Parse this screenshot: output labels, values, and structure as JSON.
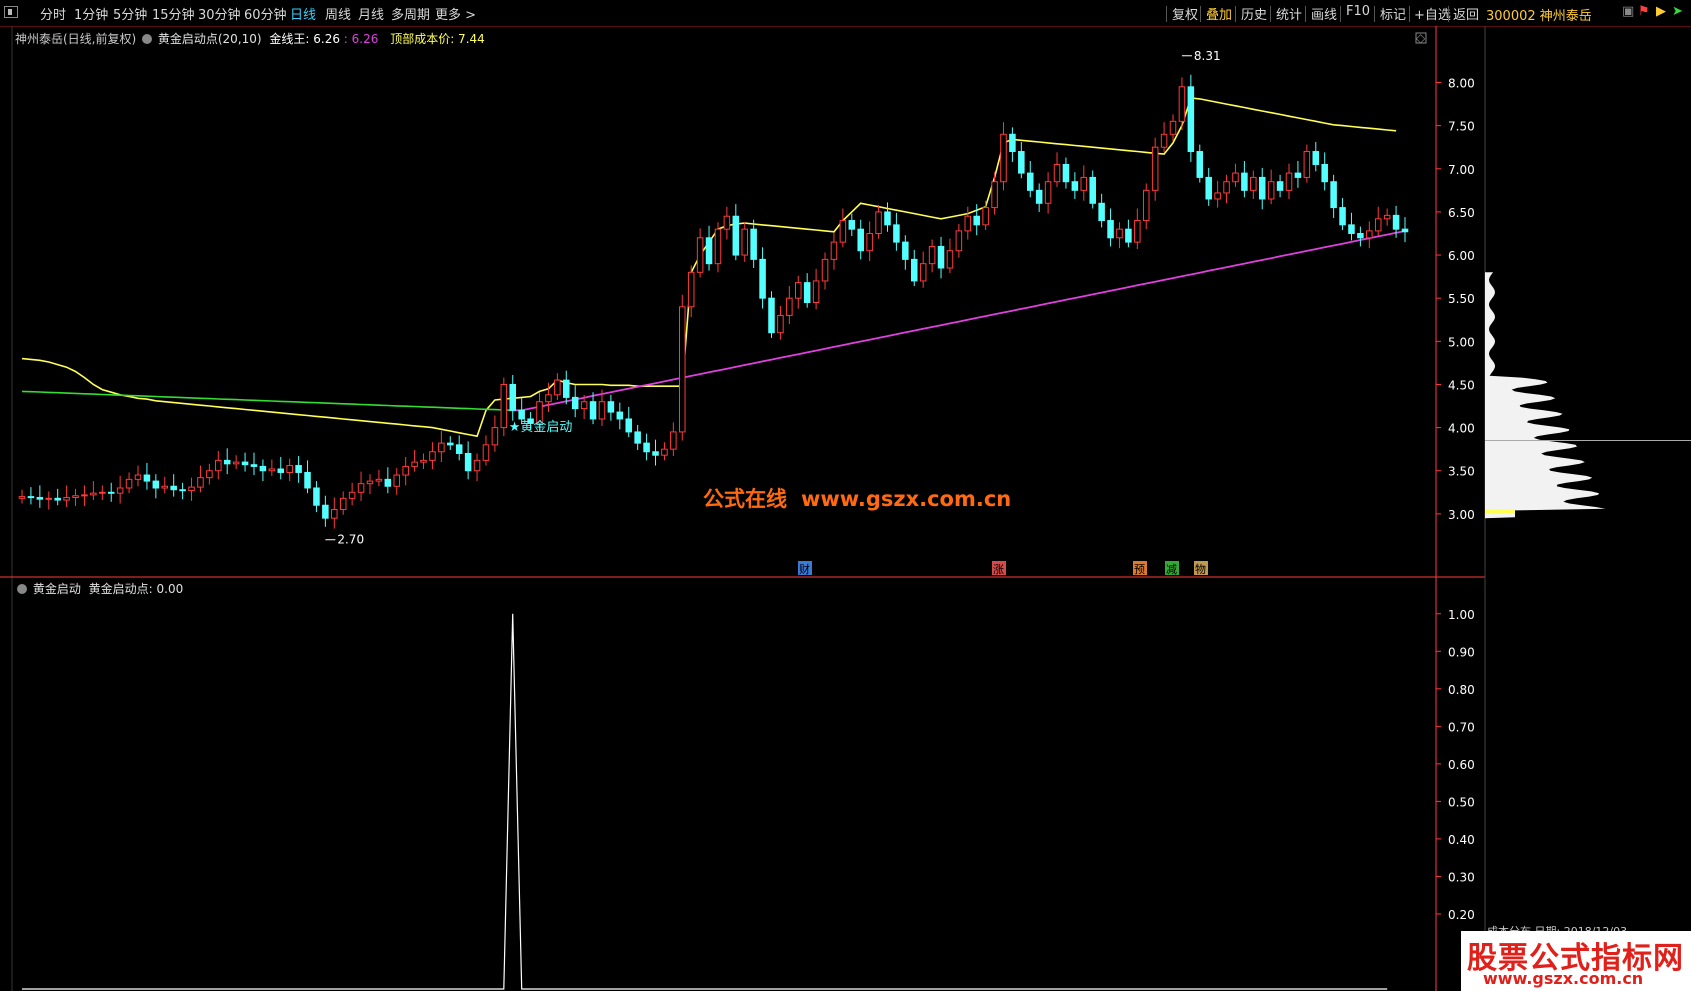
{
  "toolbar": {
    "periods": [
      "分时",
      "1分钟",
      "5分钟",
      "15分钟",
      "30分钟",
      "60分钟",
      "日线",
      "周线",
      "月线",
      "多周期",
      "更多 >"
    ],
    "active_period": "日线",
    "right": [
      "复权",
      "叠加",
      "历史",
      "统计",
      "画线",
      "F10",
      "标记",
      "+自选",
      "返回"
    ],
    "active_right": "叠加",
    "stock": "300002 神州泰岳"
  },
  "main_info": {
    "stock_label": "神州泰岳(日线,前复权)",
    "indicator": "黄金启动点(20,10)",
    "gold_label": "金线王: 6.26",
    "magenta_value": ": 6.26",
    "top_cost": "顶部成本价: 7.44"
  },
  "sub_info": {
    "name": "黄金启动",
    "value_label": "黄金启动点: 0.00"
  },
  "watermark": {
    "line1": "公式在线",
    "line2": "www.gszx.com.cn"
  },
  "corner_watermark": {
    "line1": "股票公式指标网",
    "line2": "www.gszx.com.cn"
  },
  "chip_text": "成本分布,日期: 2018/12/03",
  "colors": {
    "up": "#ff3a3a",
    "down": "#54ffff",
    "gold": "#ffff55",
    "magenta": "#e040e0",
    "green": "#33dd33",
    "axis": "#ff3a3a",
    "white": "#ffffff"
  },
  "chart_data": [
    {
      "type": "candlestick",
      "title": "神州泰岳(日线,前复权)",
      "ylim": [
        2.5,
        8.4
      ],
      "yticks": [
        3.0,
        3.5,
        4.0,
        4.5,
        5.0,
        5.5,
        6.0,
        6.5,
        7.0,
        7.5,
        8.0
      ],
      "annotations": [
        {
          "text": "8.31",
          "kind": "high"
        },
        {
          "text": "2.70",
          "kind": "low"
        },
        {
          "text": "黄金启动",
          "kind": "signal"
        }
      ],
      "event_markers": [
        "财",
        "涨",
        "预",
        "减",
        "物"
      ],
      "closes": [
        3.2,
        3.19,
        3.17,
        3.18,
        3.16,
        3.19,
        3.21,
        3.22,
        3.24,
        3.25,
        3.24,
        3.3,
        3.4,
        3.45,
        3.38,
        3.3,
        3.32,
        3.28,
        3.27,
        3.31,
        3.42,
        3.5,
        3.62,
        3.58,
        3.6,
        3.57,
        3.55,
        3.5,
        3.52,
        3.48,
        3.56,
        3.48,
        3.3,
        3.1,
        2.95,
        3.05,
        3.18,
        3.25,
        3.35,
        3.38,
        3.4,
        3.32,
        3.45,
        3.55,
        3.6,
        3.62,
        3.72,
        3.82,
        3.8,
        3.7,
        3.5,
        3.62,
        3.8,
        4.0,
        4.5,
        4.2,
        4.1,
        4.05,
        4.3,
        4.38,
        4.55,
        4.35,
        4.22,
        4.3,
        4.1,
        4.3,
        4.18,
        4.1,
        3.95,
        3.82,
        3.72,
        3.68,
        3.75,
        3.95,
        5.4,
        5.8,
        6.2,
        5.9,
        6.3,
        6.45,
        6.0,
        6.3,
        5.95,
        5.5,
        5.1,
        5.3,
        5.5,
        5.68,
        5.45,
        5.7,
        5.95,
        6.15,
        6.4,
        6.3,
        6.05,
        6.25,
        6.5,
        6.35,
        6.15,
        5.95,
        5.7,
        5.9,
        6.1,
        5.85,
        6.05,
        6.28,
        6.45,
        6.35,
        6.55,
        6.85,
        7.4,
        7.2,
        6.95,
        6.75,
        6.6,
        6.85,
        7.05,
        6.85,
        6.75,
        6.9,
        6.6,
        6.4,
        6.2,
        6.3,
        6.15,
        6.4,
        6.75,
        7.25,
        7.4,
        7.55,
        7.95,
        7.2,
        6.9,
        6.65,
        6.72,
        6.85,
        6.95,
        6.75,
        6.9,
        6.65,
        6.85,
        6.75,
        6.95,
        6.9,
        7.2,
        7.05,
        6.85,
        6.55,
        6.35,
        6.25,
        6.2,
        6.28,
        6.42,
        6.46,
        6.3,
        6.27
      ],
      "gold_line": [
        4.8,
        4.79,
        4.78,
        4.76,
        4.73,
        4.7,
        4.65,
        4.58,
        4.5,
        4.44,
        4.41,
        4.38,
        4.36,
        4.34,
        4.33,
        4.31,
        4.3,
        4.29,
        4.28,
        4.27,
        4.26,
        4.25,
        4.24,
        4.23,
        4.22,
        4.21,
        4.2,
        4.19,
        4.18,
        4.17,
        4.16,
        4.15,
        4.14,
        4.13,
        4.12,
        4.11,
        4.1,
        4.09,
        4.08,
        4.07,
        4.06,
        4.05,
        4.04,
        4.03,
        4.02,
        4.01,
        4.0,
        3.98,
        3.96,
        3.94,
        3.92,
        3.9,
        4.2,
        4.32,
        4.33,
        4.34,
        4.35,
        4.36,
        4.42,
        4.45,
        4.55,
        4.52,
        4.5,
        4.5,
        4.5,
        4.5,
        4.49,
        4.49,
        4.49,
        4.48,
        4.48,
        4.48,
        4.48,
        4.48,
        4.48,
        5.8,
        6.0,
        6.15,
        6.3,
        6.34,
        6.36,
        6.37,
        6.36,
        6.35,
        6.34,
        6.33,
        6.32,
        6.31,
        6.3,
        6.29,
        6.28,
        6.27,
        6.4,
        6.5,
        6.6,
        6.58,
        6.56,
        6.54,
        6.52,
        6.5,
        6.48,
        6.46,
        6.44,
        6.42,
        6.44,
        6.46,
        6.48,
        6.52,
        6.56,
        6.9,
        7.3,
        7.34,
        7.33,
        7.32,
        7.31,
        7.3,
        7.29,
        7.28,
        7.27,
        7.26,
        7.25,
        7.24,
        7.23,
        7.22,
        7.21,
        7.2,
        7.19,
        7.18,
        7.17,
        7.3,
        7.5,
        7.82,
        7.81,
        7.79,
        7.77,
        7.75,
        7.73,
        7.71,
        7.69,
        7.67,
        7.65,
        7.63,
        7.61,
        7.59,
        7.57,
        7.55,
        7.53,
        7.51,
        7.5,
        7.49,
        7.48,
        7.47,
        7.46,
        7.45,
        7.44
      ],
      "series_names": {
        "gold": "金线王",
        "magenta": "顶部成本价"
      }
    },
    {
      "type": "line",
      "title": "黄金启动点",
      "ylim": [
        0,
        1.05
      ],
      "yticks": [
        0.2,
        0.3,
        0.4,
        0.5,
        0.6,
        0.7,
        0.8,
        0.9,
        1.0
      ],
      "signal_index": 55,
      "values": [
        0,
        0,
        0,
        0,
        0,
        0,
        0,
        0,
        0,
        0,
        0,
        0,
        0,
        0,
        0,
        0,
        0,
        0,
        0,
        0,
        0,
        0,
        0,
        0,
        0,
        0,
        0,
        0,
        0,
        0,
        0,
        0,
        0,
        0,
        0,
        0,
        0,
        0,
        0,
        0,
        0,
        0,
        0,
        0,
        0,
        0,
        0,
        0,
        0,
        0,
        0,
        0,
        0,
        0,
        0,
        1,
        0,
        0,
        0,
        0,
        0,
        0,
        0,
        0,
        0,
        0,
        0,
        0,
        0,
        0,
        0,
        0,
        0,
        0,
        0,
        0,
        0,
        0,
        0,
        0,
        0,
        0,
        0,
        0,
        0,
        0,
        0,
        0,
        0,
        0,
        0,
        0,
        0,
        0,
        0,
        0,
        0,
        0,
        0,
        0,
        0,
        0,
        0,
        0,
        0,
        0,
        0,
        0,
        0,
        0,
        0,
        0,
        0,
        0,
        0,
        0,
        0,
        0,
        0,
        0,
        0,
        0,
        0,
        0,
        0,
        0,
        0,
        0,
        0,
        0,
        0,
        0,
        0,
        0,
        0,
        0,
        0,
        0,
        0,
        0,
        0,
        0,
        0,
        0,
        0,
        0,
        0,
        0,
        0,
        0,
        0,
        0,
        0,
        0
      ]
    }
  ]
}
